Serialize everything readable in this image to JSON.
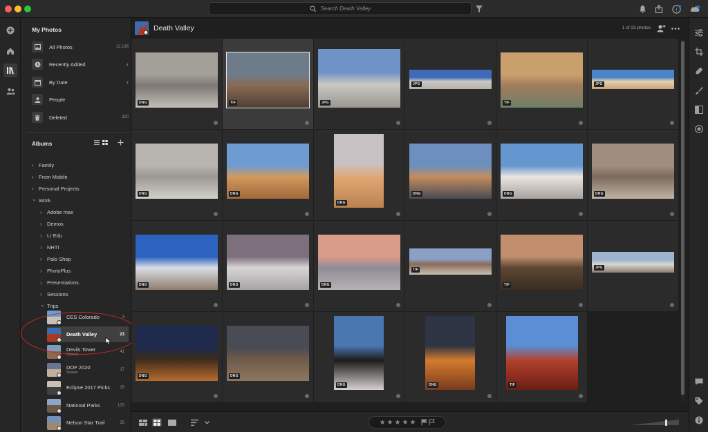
{
  "search": {
    "placeholder": "Search Death Valley"
  },
  "sidebar": {
    "my_photos_title": "My Photos",
    "items": [
      {
        "label": "All Photos",
        "count": "12,198",
        "icon": "photo-icon"
      },
      {
        "label": "Recently Added",
        "count": "",
        "icon": "clock-icon"
      },
      {
        "label": "By Date",
        "count": "",
        "icon": "calendar-icon"
      },
      {
        "label": "People",
        "count": "",
        "icon": "person-icon"
      },
      {
        "label": "Deleted",
        "count": "320",
        "icon": "trash-icon"
      }
    ],
    "albums_title": "Albums",
    "folders": [
      {
        "label": "Family",
        "level": 0,
        "open": false
      },
      {
        "label": "From Mobile",
        "level": 0,
        "open": false
      },
      {
        "label": "Personal Projects",
        "level": 0,
        "open": false
      },
      {
        "label": "Work",
        "level": 0,
        "open": true
      },
      {
        "label": "Adobe max",
        "level": 1,
        "open": false
      },
      {
        "label": "Demos",
        "level": 1,
        "open": false
      },
      {
        "label": "Lr Edu",
        "level": 1,
        "open": false
      },
      {
        "label": "NHTI",
        "level": 1,
        "open": false
      },
      {
        "label": "Palo Shop",
        "level": 1,
        "open": false
      },
      {
        "label": "PhotoPlus",
        "level": 1,
        "open": false
      },
      {
        "label": "Presentations",
        "level": 1,
        "open": false
      },
      {
        "label": "Sessions",
        "level": 1,
        "open": false
      },
      {
        "label": "Trips",
        "level": 1,
        "open": true
      }
    ],
    "albums": [
      {
        "name": "CES Colorado",
        "sub": "",
        "count": "3"
      },
      {
        "name": "Death Valley",
        "sub": "",
        "count": "23"
      },
      {
        "name": "Devils Tower",
        "sub": "Shared",
        "count": "41"
      },
      {
        "name": "DOF 2020",
        "sub": "Shared",
        "count": "17"
      },
      {
        "name": "Eclipse 2017 Picks",
        "sub": "",
        "count": "15"
      },
      {
        "name": "National Parks",
        "sub": "",
        "count": "170"
      },
      {
        "name": "Nelson Star Trail",
        "sub": "",
        "count": "25"
      }
    ]
  },
  "header": {
    "title": "Death Valley",
    "count": "1 of 23 photos"
  },
  "photos": [
    {
      "format": "DNG",
      "colors": [
        "#a39f99",
        "#7d7873",
        "#c2beb8"
      ]
    },
    {
      "format": "TIF",
      "colors": [
        "#6e7c8a",
        "#8a6a52",
        "#4d3f36"
      ]
    },
    {
      "format": "JPG",
      "colors": [
        "#6f93c7",
        "#c9c8c3",
        "#9b9892"
      ]
    },
    {
      "format": "JPG",
      "colors": [
        "#3f6ab8",
        "#c9c8c6",
        "#b9b3aa"
      ]
    },
    {
      "format": "TIF",
      "colors": [
        "#c9a06c",
        "#a07c5b",
        "#6f7f67"
      ]
    },
    {
      "format": "JPG",
      "colors": [
        "#4b83c9",
        "#e6d2ae",
        "#caa47a"
      ]
    },
    {
      "format": "DNG",
      "colors": [
        "#b8b5b0",
        "#9c9893",
        "#d2d0cb"
      ]
    },
    {
      "format": "DNG",
      "colors": [
        "#6e9bd1",
        "#d19a5e",
        "#a2683b"
      ]
    },
    {
      "format": "DNG",
      "colors": [
        "#c8c1c3",
        "#e0a672",
        "#b9824f"
      ]
    },
    {
      "format": "DNG",
      "colors": [
        "#6c8fbf",
        "#c38d5f",
        "#4a4a52"
      ]
    },
    {
      "format": "DNG",
      "colors": [
        "#6497cf",
        "#e9e4df",
        "#a7a3a0"
      ]
    },
    {
      "format": "DNG",
      "colors": [
        "#a18d7d",
        "#7c6b5d",
        "#c1b2a4"
      ]
    },
    {
      "format": "DNG",
      "colors": [
        "#2c62c0",
        "#d9dee5",
        "#8f7d6c"
      ]
    },
    {
      "format": "DNG",
      "colors": [
        "#7e6f7c",
        "#d8d5d5",
        "#a8a4a6"
      ]
    },
    {
      "format": "DNG",
      "colors": [
        "#d99b8a",
        "#8f8c95",
        "#b6b1b3"
      ]
    },
    {
      "format": "TIF",
      "colors": [
        "#8aa0c6",
        "#8a6b56",
        "#c6bfb8"
      ]
    },
    {
      "format": "TIF",
      "colors": [
        "#c18e6e",
        "#5c4632",
        "#3a2d23"
      ]
    },
    {
      "format": "JPG",
      "colors": [
        "#9fb5cf",
        "#d8d6d2",
        "#8e7e6e"
      ]
    },
    {
      "format": "DNG",
      "colors": [
        "#1d2a4b",
        "#3b2a1c",
        "#b76b2e"
      ]
    },
    {
      "format": "DNG",
      "colors": [
        "#494b55",
        "#6f5a4a",
        "#8e7660"
      ]
    },
    {
      "format": "DNG",
      "colors": [
        "#4a77b0",
        "#1f1b1a",
        "#d4d1d0"
      ]
    },
    {
      "format": "DNG",
      "colors": [
        "#2d3444",
        "#d37b2f",
        "#7a3b1d"
      ]
    },
    {
      "format": "TIF",
      "colors": [
        "#5a8fd6",
        "#b3412d",
        "#6b1d14"
      ]
    }
  ],
  "selected_index": 1,
  "colors": {
    "selection_ring": "#d0252a",
    "accent": "#1473e6"
  }
}
